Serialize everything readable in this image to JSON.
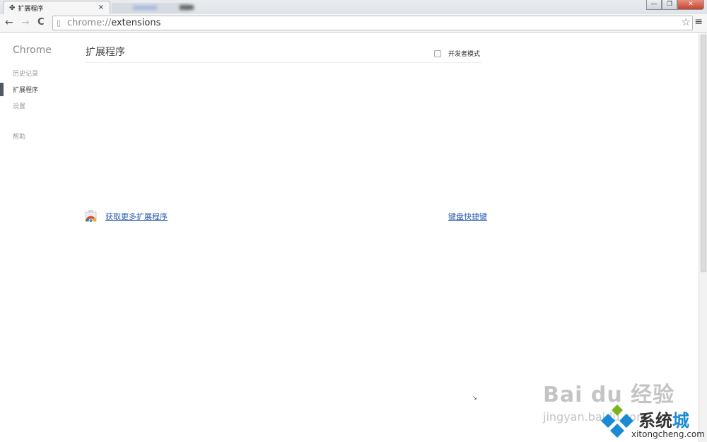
{
  "window": {
    "tab_title": "扩展程序",
    "tab_close": "×",
    "min": "—",
    "max": "❐",
    "close": "✕"
  },
  "toolbar": {
    "back": "←",
    "forward": "→",
    "reload": "C",
    "url_prefix": "chrome://",
    "url_main": "extensions",
    "star": "☆",
    "menu": "≡"
  },
  "sidebar": {
    "title": "Chrome",
    "items": [
      {
        "label": "历史记录",
        "selected": false
      },
      {
        "label": "扩展程序",
        "selected": true
      },
      {
        "label": "设置",
        "selected": false
      },
      {
        "label": "帮助",
        "selected": false
      }
    ]
  },
  "main": {
    "title": "扩展程序",
    "developer_mode_label": "开发者模式",
    "developer_mode_checked": false,
    "get_more_link": "获取更多扩展程序",
    "keyboard_shortcuts_link": "键盘快捷键"
  },
  "watermarks": {
    "baidu": "Bai du 经验",
    "baidu_sub": "jingyan.baidu.com",
    "xitongcheng_name_a": "系统",
    "xitongcheng_name_b": "城",
    "xitongcheng_url": "xitongcheng.com"
  },
  "colors": {
    "link": "#2a5db0",
    "selected_bar": "#4f5867",
    "close_button": "#c8432c"
  }
}
